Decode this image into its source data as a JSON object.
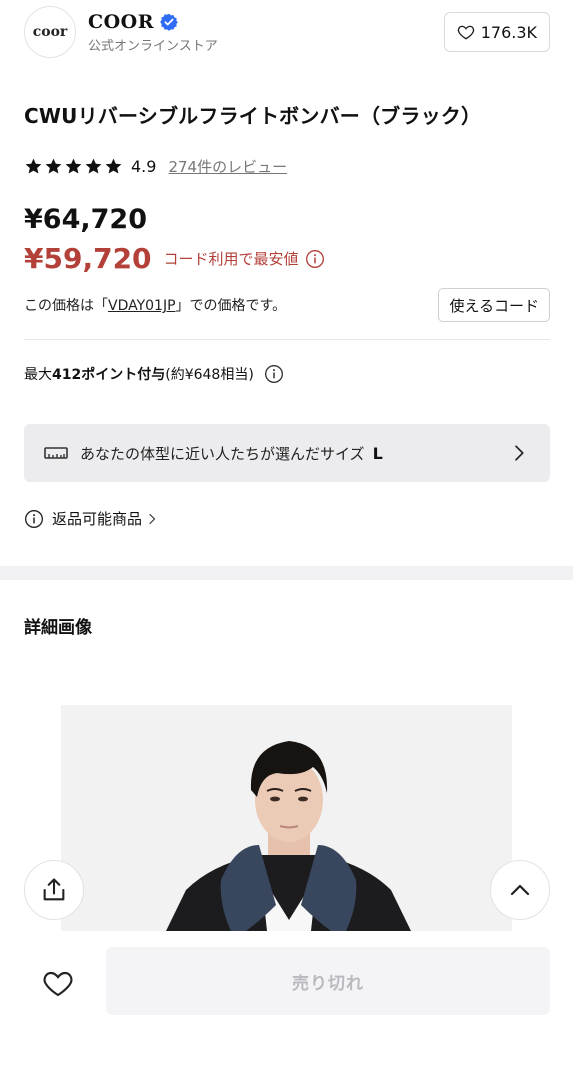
{
  "brand": {
    "logo_text": "coor",
    "name": "COOR",
    "subtitle": "公式オンラインストア",
    "likes": "176.3K"
  },
  "product": {
    "title": "CWUリバーシブルフライトボンバー（ブラック）",
    "rating": "4.9",
    "rating_stars": 5,
    "review_link": "274件のレビュー",
    "original_price": "¥64,720",
    "sale_price": "¥59,720",
    "sale_note": "コード利用で最安値",
    "code_text_prefix": "この価格は「",
    "code": "VDAY01JP",
    "code_text_suffix": "」での価格です。",
    "use_code_label": "使えるコード"
  },
  "points": {
    "prefix": "最大",
    "bold": "412ポイント付与",
    "suffix": "(約¥648相当)"
  },
  "size_recommendation": {
    "text": "あなたの体型に近い人たちが選んだサイズ",
    "size": "L"
  },
  "returns": {
    "label": "返品可能商品"
  },
  "details": {
    "title": "詳細画像"
  },
  "bottom": {
    "buy_label": "売り切れ"
  },
  "colors": {
    "sale_red": "#b3413a",
    "verified_blue": "#2f6cf6",
    "size_bar_bg": "#ececef",
    "soldout_bg": "#f4f4f6"
  }
}
